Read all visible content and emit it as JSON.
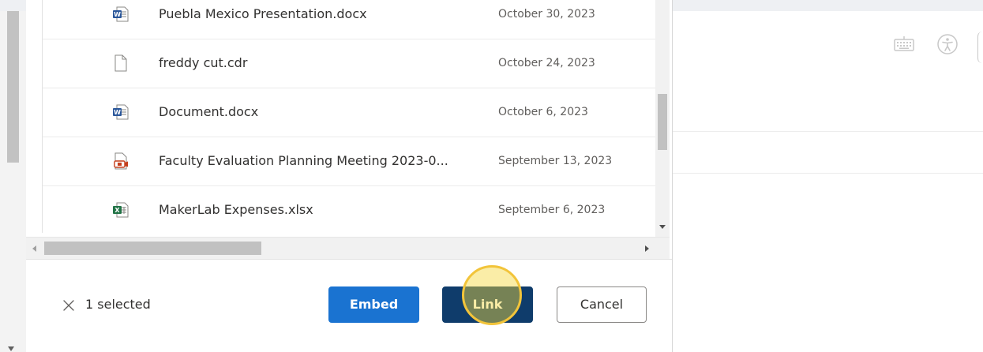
{
  "files": [
    {
      "name": "Puebla Mexico Presentation.docx",
      "date": "October 30, 2023",
      "type": "word"
    },
    {
      "name": "freddy cut.cdr",
      "date": "October 24, 2023",
      "type": "generic"
    },
    {
      "name": "Document.docx",
      "date": "October 6, 2023",
      "type": "word"
    },
    {
      "name": "Faculty Evaluation Planning Meeting 2023-0...",
      "date": "September 13, 2023",
      "type": "recording"
    },
    {
      "name": "MakerLab Expenses.xlsx",
      "date": "September 6, 2023",
      "type": "excel"
    }
  ],
  "footer": {
    "selected_text": "1 selected",
    "embed_label": "Embed",
    "link_label": "Link",
    "cancel_label": "Cancel"
  },
  "icons": {
    "word": "word-file-icon",
    "generic": "generic-file-icon",
    "recording": "recording-file-icon",
    "excel": "excel-file-icon",
    "keyboard": "keyboard-icon",
    "accessibility": "accessibility-icon",
    "clear": "close-icon"
  },
  "colors": {
    "embed_button": "#1a73d1",
    "link_button": "#0f3c6b",
    "highlight": "#f2c43a",
    "word": "#2b579a",
    "excel": "#217346",
    "recording": "#c43e1c"
  }
}
